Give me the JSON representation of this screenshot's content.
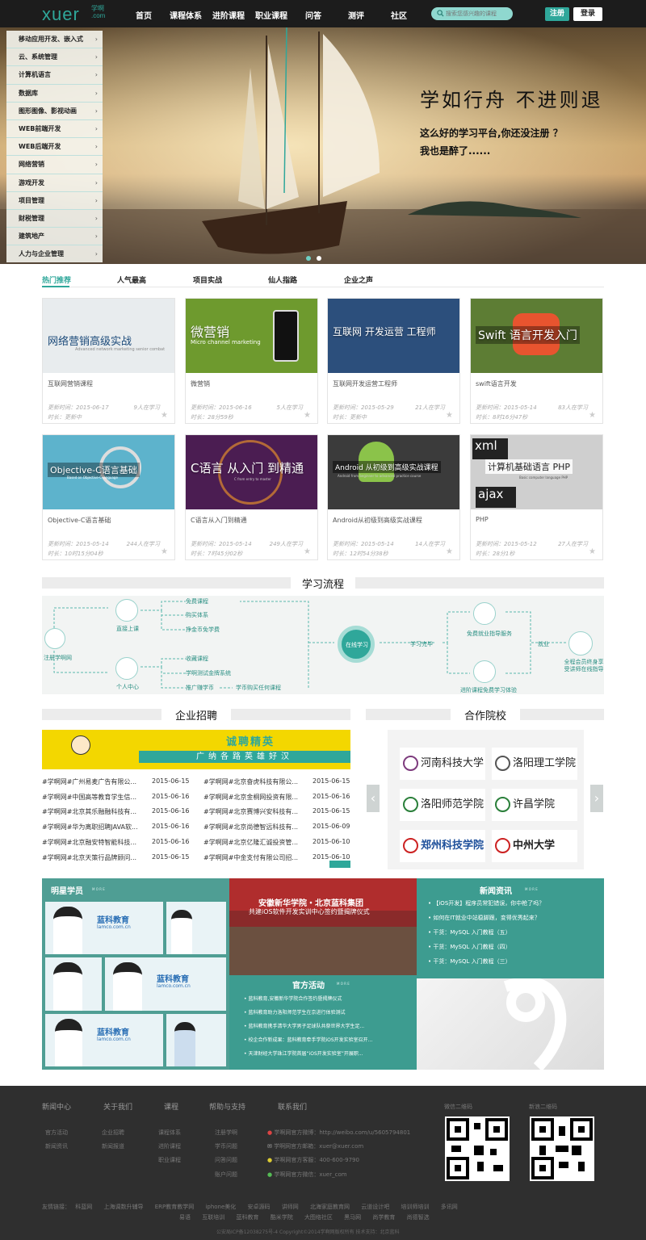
{
  "header": {
    "logo": "xuer",
    "logo_sub1": "学啊",
    "logo_sub2": ".com",
    "nav": [
      "首页",
      "课程体系",
      "进阶课程",
      "职业课程",
      "问答",
      "测评",
      "社区"
    ],
    "search_placeholder": "搜索您感兴趣的课程",
    "register": "注册",
    "login": "登录"
  },
  "sidebar": {
    "items": [
      "移动应用开发、嵌入式",
      "云、系统管理",
      "计算机语言",
      "数据库",
      "图形图像、影视动画",
      "WEB前端开发",
      "WEB后端开发",
      "网络营销",
      "游戏开发",
      "项目管理",
      "财税管理",
      "建筑地产",
      "人力与企业管理"
    ]
  },
  "banner": {
    "slogan": "学如行舟  不进则退",
    "line1": "这么好的学习平台,你还没注册 ？",
    "line2": "我也是醉了......"
  },
  "tabs": [
    "热门推荐",
    "人气最高",
    "项目实战",
    "仙人指路",
    "企业之声"
  ],
  "courses": [
    {
      "thumb": "网络营销高级实战",
      "thumb_sub": "Advanced network marketing senior combat",
      "name": "互联网营销课程",
      "updated": "更新时间：2015-06-17",
      "learners": "9人在学习",
      "duration": "时长：更新中",
      "color": "#e8ecee"
    },
    {
      "thumb": "微营销",
      "thumb_sub": "Micro channel marketing",
      "name": "微营销",
      "updated": "更新时间：2015-06-16",
      "learners": "5人在学习",
      "duration": "时长：28分59秒",
      "color": "#6e9a2e"
    },
    {
      "thumb": "互联网 开发运营 工程师",
      "thumb_sub": "",
      "name": "互联网开发运营工程师",
      "updated": "更新时间：2015-05-29",
      "learners": "21人在学习",
      "duration": "时长：更新中",
      "color": "#2c4f7c"
    },
    {
      "thumb": "Swift 语言开发入门",
      "thumb_sub": "",
      "name": "swift语言开发",
      "updated": "更新时间：2015-05-14",
      "learners": "83人在学习",
      "duration": "时长：8时16分47秒",
      "color": "#5d7d34"
    },
    {
      "thumb": "Objective-C语言基础",
      "thumb_sub": "Based on Objective-C language",
      "name": "Objective-C语言基础",
      "updated": "更新时间：2015-05-14",
      "learners": "244人在学习",
      "duration": "时长：10时15分04秒",
      "color": "#5db3cc"
    },
    {
      "thumb": "C语言 从入门 到精通",
      "thumb_sub": "C from entry to master",
      "name": "C语言从入门到精通",
      "updated": "更新时间：2015-05-14",
      "learners": "249人在学习",
      "duration": "时长：7时45分02秒",
      "color": "#4b1d52"
    },
    {
      "thumb": "Android 从初级到高级实战课程",
      "thumb_sub": "Android from beginner to advanced practice course",
      "name": "Android从初级到高级实战课程",
      "updated": "更新时间：2015-05-14",
      "learners": "14人在学习",
      "duration": "时长：12时54分38秒",
      "color": "#3b3b3b"
    },
    {
      "thumb": "计算机基础语言 PHP",
      "thumb_sub": "Basic computer language PHP",
      "name": "PHP",
      "updated": "更新时间：2015-05-12",
      "learners": "27人在学习",
      "duration": "时长：28分1秒",
      "color": "#cfcfcf"
    }
  ],
  "process": {
    "title": "学习流程",
    "register": "注册学啊网",
    "direct": "直接上课",
    "personal": "个人中心",
    "free": "免费课程",
    "buy": "购买体系",
    "coin": "挣金币免学费",
    "collect": "收藏课程",
    "test": "学啊测试金牌系统",
    "promote": "推广赚学币",
    "coin_pay": "学币购买任何课程",
    "online": "在线学习",
    "complete": "学习完毕",
    "employ": "免费就业指导服务",
    "advanced": "进阶课程免费学习体验",
    "job": "就业",
    "vip": "全程会员终身享受讲师在线指导"
  },
  "recruit": {
    "title": "企业招聘",
    "banner_title": "诚聘精英",
    "banner_sub": "广纳各路英雄好汉",
    "jobs_left": [
      {
        "t": "#学啊网#广州易麦广告有限公...",
        "d": "2015-06-15"
      },
      {
        "t": "#学啊网#中国高等教育学生信...",
        "d": "2015-06-16"
      },
      {
        "t": "#学啊网#北京其乐融融科技有...",
        "d": "2015-06-16"
      },
      {
        "t": "#学啊网#华为离职招聘JAVA软...",
        "d": "2015-06-16"
      },
      {
        "t": "#学啊网#北京融安特智能科技...",
        "d": "2015-06-16"
      },
      {
        "t": "#学啊网#北京天策行品牌顾问...",
        "d": "2015-06-15"
      }
    ],
    "jobs_right": [
      {
        "t": "#学啊网#北京奋虎科技有限公...",
        "d": "2015-06-15"
      },
      {
        "t": "#学啊网#北京金桐网投资有限...",
        "d": "2015-06-16"
      },
      {
        "t": "#学啊网#北京赛博兴安科技有...",
        "d": "2015-06-15"
      },
      {
        "t": "#学啊网#北京尚德智远科技有...",
        "d": "2015-06-09"
      },
      {
        "t": "#学啊网#北京亿隆汇诚投资管...",
        "d": "2015-06-10"
      },
      {
        "t": "#学啊网#中金支付有限公司招...",
        "d": "2015-06-10"
      }
    ]
  },
  "schools": {
    "title": "合作院校",
    "items": [
      "河南科技大学",
      "洛阳理工学院",
      "洛阳师范学院",
      "许昌学院",
      "郑州科技学院",
      "中州大学"
    ]
  },
  "showcase": {
    "stars_title": "明星学员",
    "more": "M O R E",
    "brand": "蓝科教育",
    "brand_url": "lamco.com.cn",
    "event_title": "安徽新华学院・北京蓝科集团",
    "event_sub": "共建iOS软件开发实训中心签约暨揭牌仪式",
    "activities_title": "官方活动",
    "activities": [
      "蓝科教育,安徽新华学院合作签约暨揭牌仪式",
      "蓝科教育助力洛阳师范学生在京进行体验测试",
      "蓝科教育携手清华大学男子足球队共祭世界大学生足...",
      "校企合作新成果：蓝科教育牵手学院iOS开发实验室召开...",
      "天津财经大学珠江学院首届“iOS开发实验室”开展职..."
    ],
    "news_title": "新闻资讯",
    "news": [
      "【iOS开发】程序员常犯错误，你中枪了吗？",
      "如何在IT就业中站稳脚跟，变得优秀起来？",
      "干货：MySQL 入门教程（五）",
      "干货：MySQL 入门教程（四）",
      "干货：MySQL 入门教程（三）"
    ]
  },
  "footer": {
    "heads": [
      "新闻中心",
      "关于我们",
      "课程",
      "帮助与支持",
      "联系我们"
    ],
    "col1": [
      "官方活动",
      "新闻资讯"
    ],
    "col2": [
      "企业招聘",
      "新闻报道"
    ],
    "col3": [
      "课程体系",
      "进阶课程",
      "职业课程"
    ],
    "col4": [
      "注册学啊",
      "学币问题",
      "问答问题",
      "账户问题"
    ],
    "contact": [
      "学啊网官方微博：http://weibo.com/u/5605794801",
      "学啊网官方邮箱：xuer@xuer.com",
      "学啊网官方客服：400-600-9790",
      "学啊网官方微信：xuer_com"
    ],
    "qr1": "微信二维码",
    "qr2": "新浪二维码",
    "links_label": "友情链接：",
    "links1": [
      "科蓝网",
      "上海调数升辅导",
      "ERP教育教学网",
      "iphone美化",
      "安卓源码",
      "讲师网",
      "北海家庭教育网",
      "云道设计吧",
      "培训师培训",
      "多讯网"
    ],
    "links2": [
      "易语",
      "互联培训",
      "蓝科教育",
      "酷米学院",
      "大图络社区",
      "黑马网",
      "尚学教育",
      "尚德智选"
    ],
    "copyright": "公安局ICP备12038275号-4   Copyright©2014学啊网版权所有   技术支持：北京蓝科"
  }
}
